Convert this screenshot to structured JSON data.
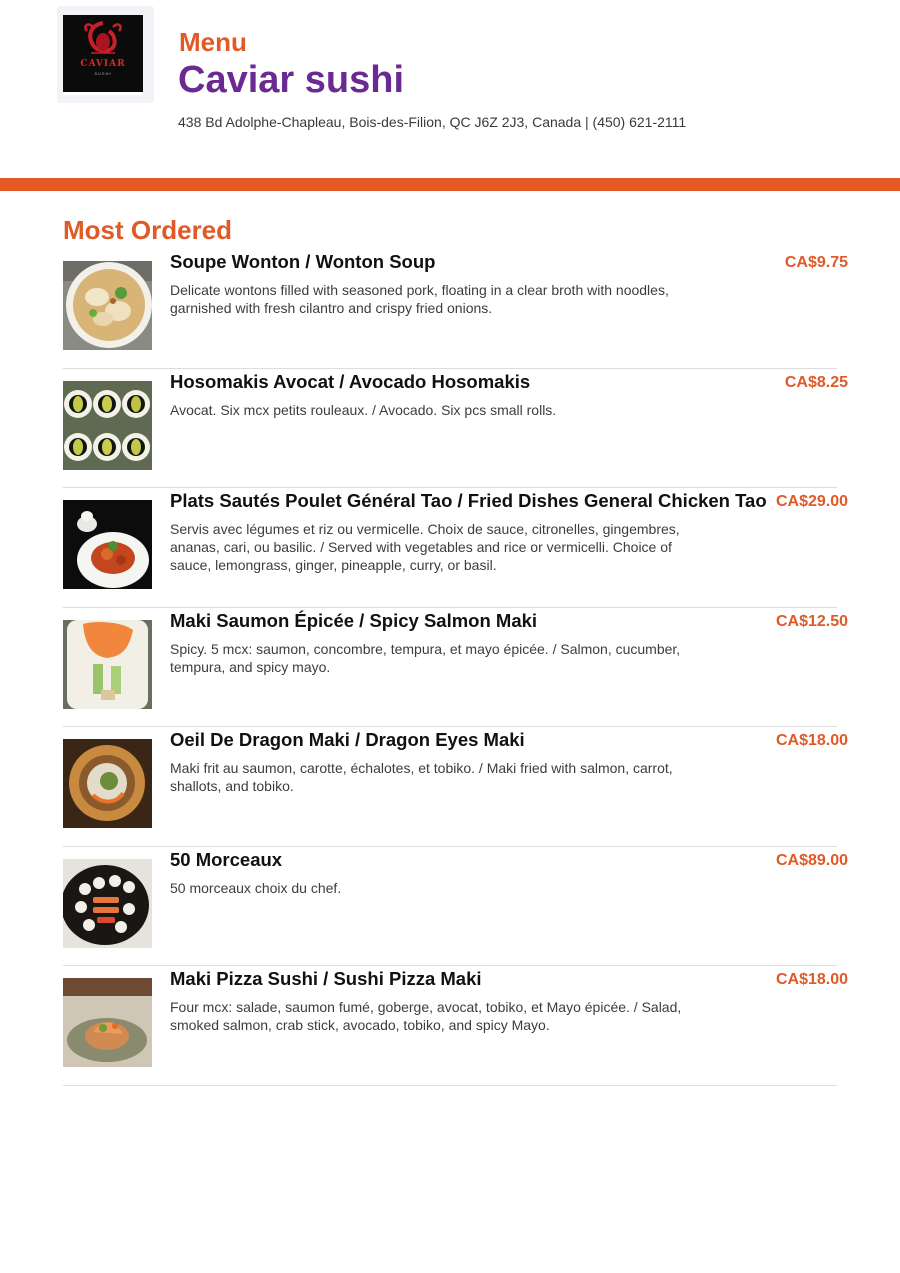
{
  "header": {
    "menu_label": "Menu",
    "restaurant_name": "Caviar sushi",
    "address": "438 Bd Adolphe-Chapleau, Bois-des-Filion, QC J6Z 2J3, Canada | (450) 621-2111",
    "logo_text": "CAVIAR",
    "logo_subtext": "SUSHI"
  },
  "colors": {
    "accent": "#e05a28",
    "brand": "#6a2a91",
    "divider": "#e45a27"
  },
  "section": {
    "title": "Most Ordered"
  },
  "items": [
    {
      "name": "Soupe Wonton / Wonton Soup",
      "price": "CA$9.75",
      "description": "Delicate wontons filled with seasoned pork, floating in a clear broth with noodles, garnished with fresh cilantro and crispy fried onions.",
      "image": "wonton-soup-photo"
    },
    {
      "name": "Hosomakis Avocat / Avocado Hosomakis",
      "price": "CA$8.25",
      "description": "Avocat. Six mcx petits rouleaux. / Avocado. Six pcs small rolls.",
      "image": "avocado-hosomaki-photo"
    },
    {
      "name": "Plats Sautés Poulet Général Tao / Fried Dishes General Chicken Tao",
      "price": "CA$29.00",
      "description": "Servis avec légumes et riz ou vermicelle. Choix de sauce, citronelles, gingembres, ananas, cari, ou basilic. / Served with vegetables and rice or vermicelli. Choice of sauce, lemongrass, ginger, pineapple, curry, or basil.",
      "image": "general-tao-photo"
    },
    {
      "name": "Maki Saumon Épicée / Spicy Salmon Maki",
      "price": "CA$12.50",
      "description": "Spicy. 5 mcx: saumon, concombre, tempura, et mayo épicée. / Salmon, cucumber, tempura, and spicy mayo.",
      "image": "spicy-salmon-maki-photo"
    },
    {
      "name": "Oeil De Dragon Maki / Dragon Eyes Maki",
      "price": "CA$18.00",
      "description": "Maki frit au saumon, carotte, échalotes, et tobiko. / Maki fried with salmon, carrot, shallots, and tobiko.",
      "image": "dragon-eyes-maki-photo"
    },
    {
      "name": "50 Morceaux",
      "price": "CA$89.00",
      "description": "50 morceaux choix du chef.",
      "image": "sushi-platter-photo"
    },
    {
      "name": "Maki Pizza Sushi / Sushi Pizza Maki",
      "price": "CA$18.00",
      "description": "Four mcx: salade, saumon fumé, goberge, avocat, tobiko, et Mayo épicée. / Salad, smoked salmon, crab stick, avocado, tobiko, and spicy Mayo.",
      "image": "sushi-pizza-photo"
    }
  ]
}
